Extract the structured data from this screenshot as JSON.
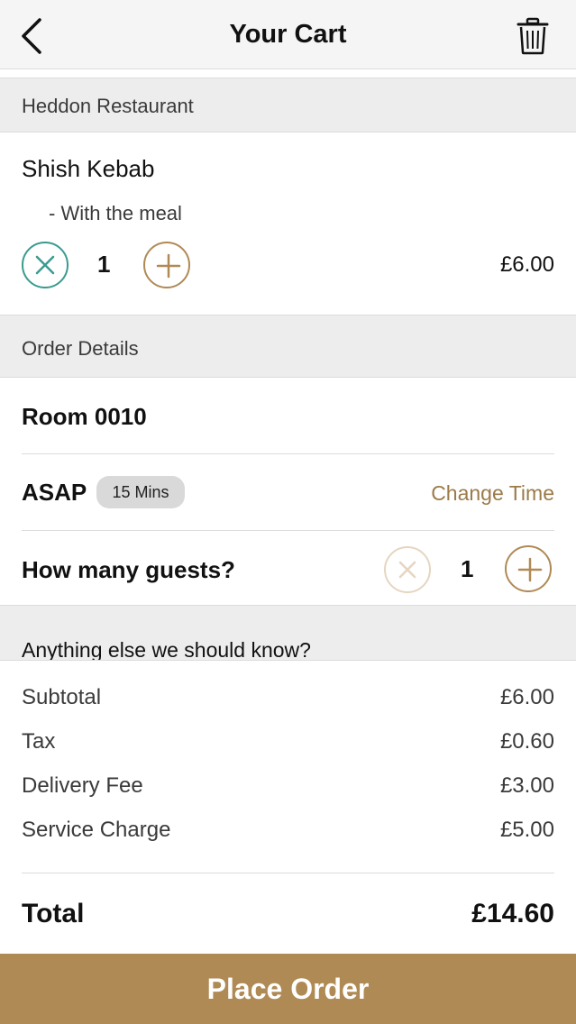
{
  "header": {
    "title": "Your Cart",
    "back_icon": "chevron-left-icon",
    "trash_icon": "trash-icon"
  },
  "restaurant": {
    "name": "Heddon Restaurant"
  },
  "cart_item": {
    "name": "Shish Kebab",
    "modifier": "- With the meal",
    "quantity": "1",
    "price": "£6.00"
  },
  "order_details": {
    "header": "Order Details",
    "room": "Room 0010",
    "timing": "ASAP",
    "eta_badge": "15 Mins",
    "change_time": "Change Time",
    "guests_label": "How many guests?",
    "guests_count": "1",
    "notes_prompt": "Anything else we should know?"
  },
  "summary": {
    "rows": [
      {
        "label": "Subtotal",
        "value": "£6.00"
      },
      {
        "label": "Tax",
        "value": "£0.60"
      },
      {
        "label": "Delivery Fee",
        "value": "£3.00"
      },
      {
        "label": "Service Charge",
        "value": "£5.00"
      }
    ],
    "total_label": "Total",
    "total_value": "£14.60"
  },
  "actions": {
    "place_order": "Place Order"
  },
  "colors": {
    "accent": "#b08a55",
    "teal": "#3a9b90",
    "header_bg": "#f5f5f5",
    "section_bg": "#ededed"
  }
}
